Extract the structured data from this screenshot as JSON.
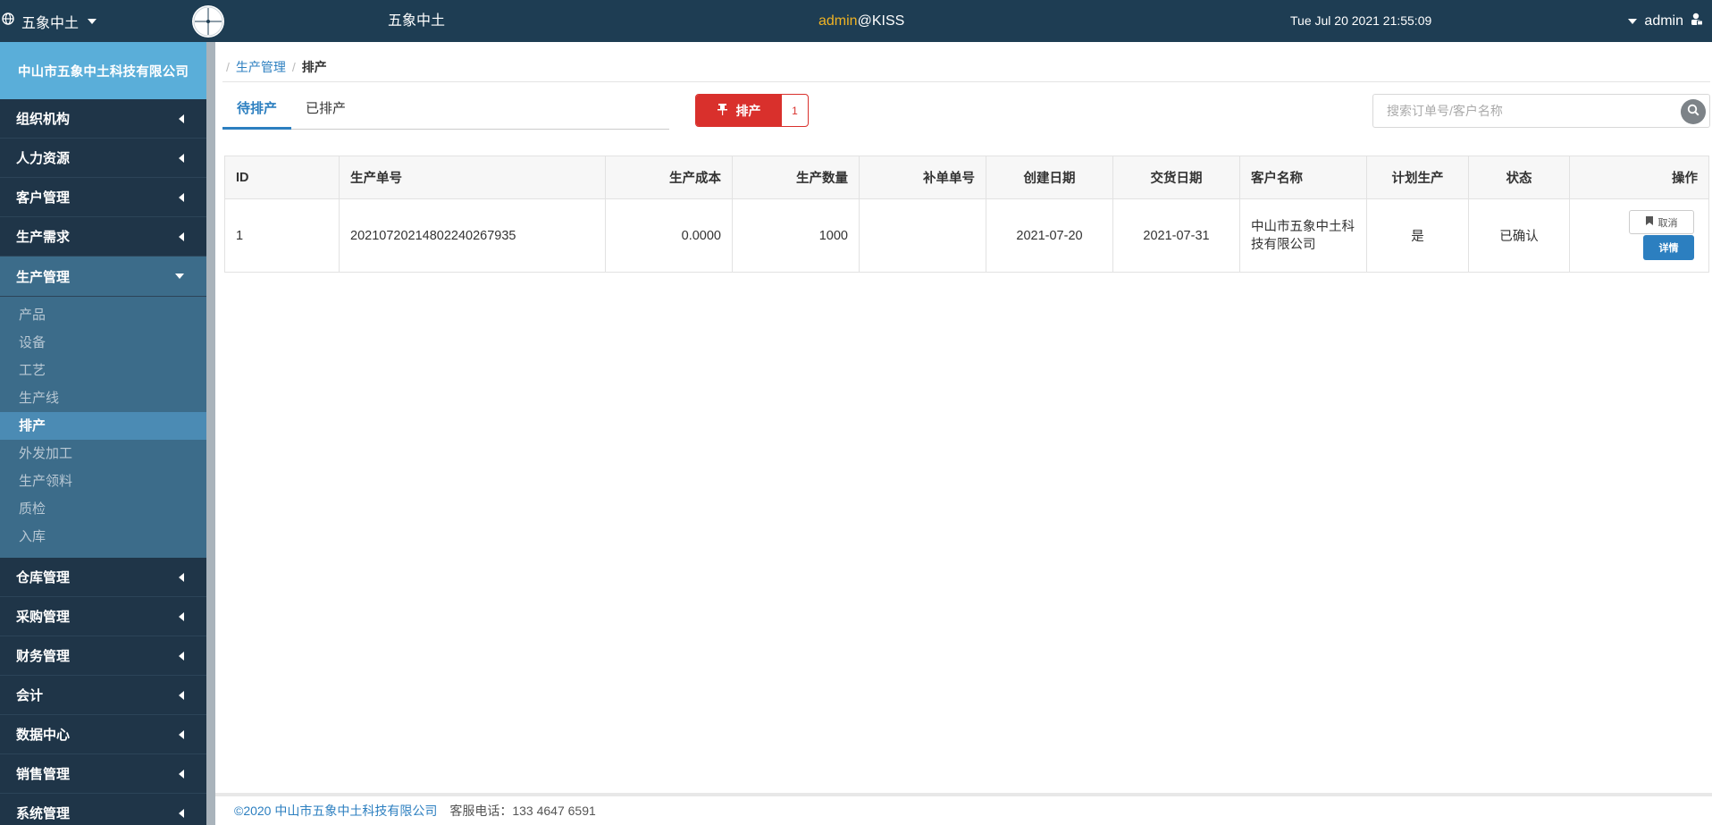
{
  "topbar": {
    "org_switch": "五象中土",
    "app_name": "五象中土",
    "user": "admin",
    "host_suffix": "@KISS",
    "clock": "Tue Jul 20 2021 21:55:09",
    "account": "admin"
  },
  "sidebar": {
    "company": "中山市五象中土科技有限公司",
    "menus_top": [
      {
        "label": "组织机构"
      },
      {
        "label": "人力资源"
      },
      {
        "label": "客户管理"
      },
      {
        "label": "生产需求"
      }
    ],
    "open_menu": {
      "label": "生产管理"
    },
    "sub_items": [
      {
        "label": "产品"
      },
      {
        "label": "设备"
      },
      {
        "label": "工艺"
      },
      {
        "label": "生产线"
      },
      {
        "label": "排产"
      },
      {
        "label": "外发加工"
      },
      {
        "label": "生产领料"
      },
      {
        "label": "质检"
      },
      {
        "label": "入库"
      }
    ],
    "menus_bottom": [
      {
        "label": "仓库管理"
      },
      {
        "label": "采购管理"
      },
      {
        "label": "财务管理"
      },
      {
        "label": "会计"
      },
      {
        "label": "数据中心"
      },
      {
        "label": "销售管理"
      },
      {
        "label": "系统管理"
      }
    ]
  },
  "breadcrumb": {
    "parent": "生产管理",
    "current": "排产"
  },
  "tabs": [
    {
      "label": "待排产"
    },
    {
      "label": "已排产"
    }
  ],
  "schedule_button": {
    "label": "排产",
    "count": "1"
  },
  "search": {
    "placeholder": "搜索订单号/客户名称",
    "value": ""
  },
  "table": {
    "headers": [
      "ID",
      "生产单号",
      "生产成本",
      "生产数量",
      "补单单号",
      "创建日期",
      "交货日期",
      "客户名称",
      "计划生产",
      "状态",
      "操作"
    ],
    "rows": [
      {
        "id": "1",
        "order_no": "20210720214802240267935",
        "cost": "0.0000",
        "quantity": "1000",
        "supplement_no": "",
        "created": "2021-07-20",
        "delivery": "2021-07-31",
        "customer": "中山市五象中土科技有限公司",
        "planned": "是",
        "status": "已确认",
        "cancel_label": "取消",
        "detail_label": "详情"
      }
    ]
  },
  "footer": {
    "copyright": "©2020  中山市五象中土科技有限公司",
    "tel": "客服电话：133 4647 6591"
  },
  "colors": {
    "topbar": "#1e3d53",
    "sidebar": "#1f3548",
    "company": "#5aaed9",
    "submenu": "#3c6c8a",
    "active_sub": "#4b8bb4",
    "accent": "#2c7fc0",
    "danger": "#d9302c"
  },
  "icons": {
    "org": "globe-icon",
    "account": "user-lock-icon",
    "search": "search-icon",
    "pin": "pin-icon",
    "bookmark": "bookmark-icon"
  }
}
